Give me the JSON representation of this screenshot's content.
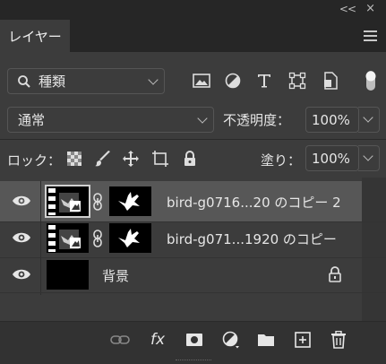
{
  "window": {
    "collapse_glyph": "<<",
    "close_glyph": "×"
  },
  "tab": {
    "label": "レイヤー"
  },
  "filter": {
    "kind_label": "種類"
  },
  "blend": {
    "mode": "通常"
  },
  "opacity": {
    "label": "不透明度：",
    "value": "100%"
  },
  "lock": {
    "label": "ロック："
  },
  "fill": {
    "label": "塗り：",
    "value": "100%"
  },
  "layers": [
    {
      "name": "bird-g0716...20 のコピー 2",
      "selected": true,
      "visible": true
    },
    {
      "name": "bird-g071...1920 のコピー",
      "selected": false,
      "visible": true
    },
    {
      "name": "背景",
      "selected": false,
      "visible": true,
      "locked": true
    }
  ],
  "bottom_bar": {
    "fx_label": "fx"
  },
  "colors": {
    "panel_bg": "#3c3c3c",
    "selected_row": "#575757",
    "strip_bg": "#262626"
  }
}
